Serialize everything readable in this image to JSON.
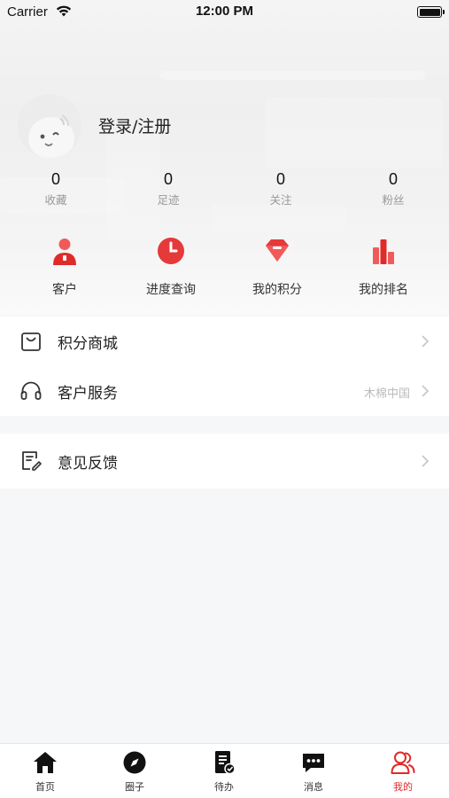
{
  "status_bar": {
    "carrier": "Carrier",
    "time": "12:00 PM"
  },
  "profile": {
    "login_label": "登录/注册"
  },
  "stats": [
    {
      "value": "0",
      "label": "收藏"
    },
    {
      "value": "0",
      "label": "足迹"
    },
    {
      "value": "0",
      "label": "关注"
    },
    {
      "value": "0",
      "label": "粉丝"
    }
  ],
  "quick_actions": [
    {
      "label": "客户",
      "icon": "customer-icon"
    },
    {
      "label": "进度查询",
      "icon": "clock-icon"
    },
    {
      "label": "我的积分",
      "icon": "diamond-icon"
    },
    {
      "label": "我的排名",
      "icon": "bar-chart-icon"
    }
  ],
  "menu": {
    "points_mall": {
      "label": "积分商城",
      "icon": "shopping-bag-icon"
    },
    "customer_service": {
      "label": "客户服务",
      "extra": "木棉中国",
      "icon": "headset-icon"
    },
    "feedback": {
      "label": "意见反馈",
      "icon": "edit-note-icon"
    }
  },
  "tabbar": [
    {
      "label": "首页",
      "icon": "home-icon"
    },
    {
      "label": "圈子",
      "icon": "compass-icon"
    },
    {
      "label": "待办",
      "icon": "todo-icon"
    },
    {
      "label": "消息",
      "icon": "message-icon"
    },
    {
      "label": "我的",
      "icon": "user-icon",
      "active": true
    }
  ],
  "colors": {
    "accent": "#e02b2b",
    "accent_light": "#f25a5a"
  }
}
